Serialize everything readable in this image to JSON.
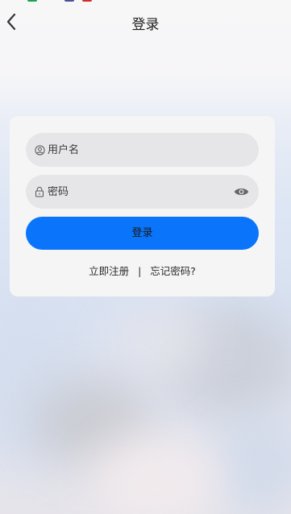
{
  "header": {
    "title": "登录",
    "back_icon": "chevron-left-icon"
  },
  "form": {
    "username": {
      "placeholder": "用户名",
      "value": "",
      "icon": "user-circle-icon"
    },
    "password": {
      "placeholder": "密码",
      "value": "",
      "icon": "lock-icon",
      "toggle_icon": "eye-icon"
    },
    "submit_label": "登录"
  },
  "links": {
    "register": "立即注册",
    "separator": "|",
    "forgot": "忘记密码?"
  },
  "colors": {
    "primary": "#0a74fb",
    "card": "#f5f5f6",
    "field": "#e6e6e8"
  }
}
